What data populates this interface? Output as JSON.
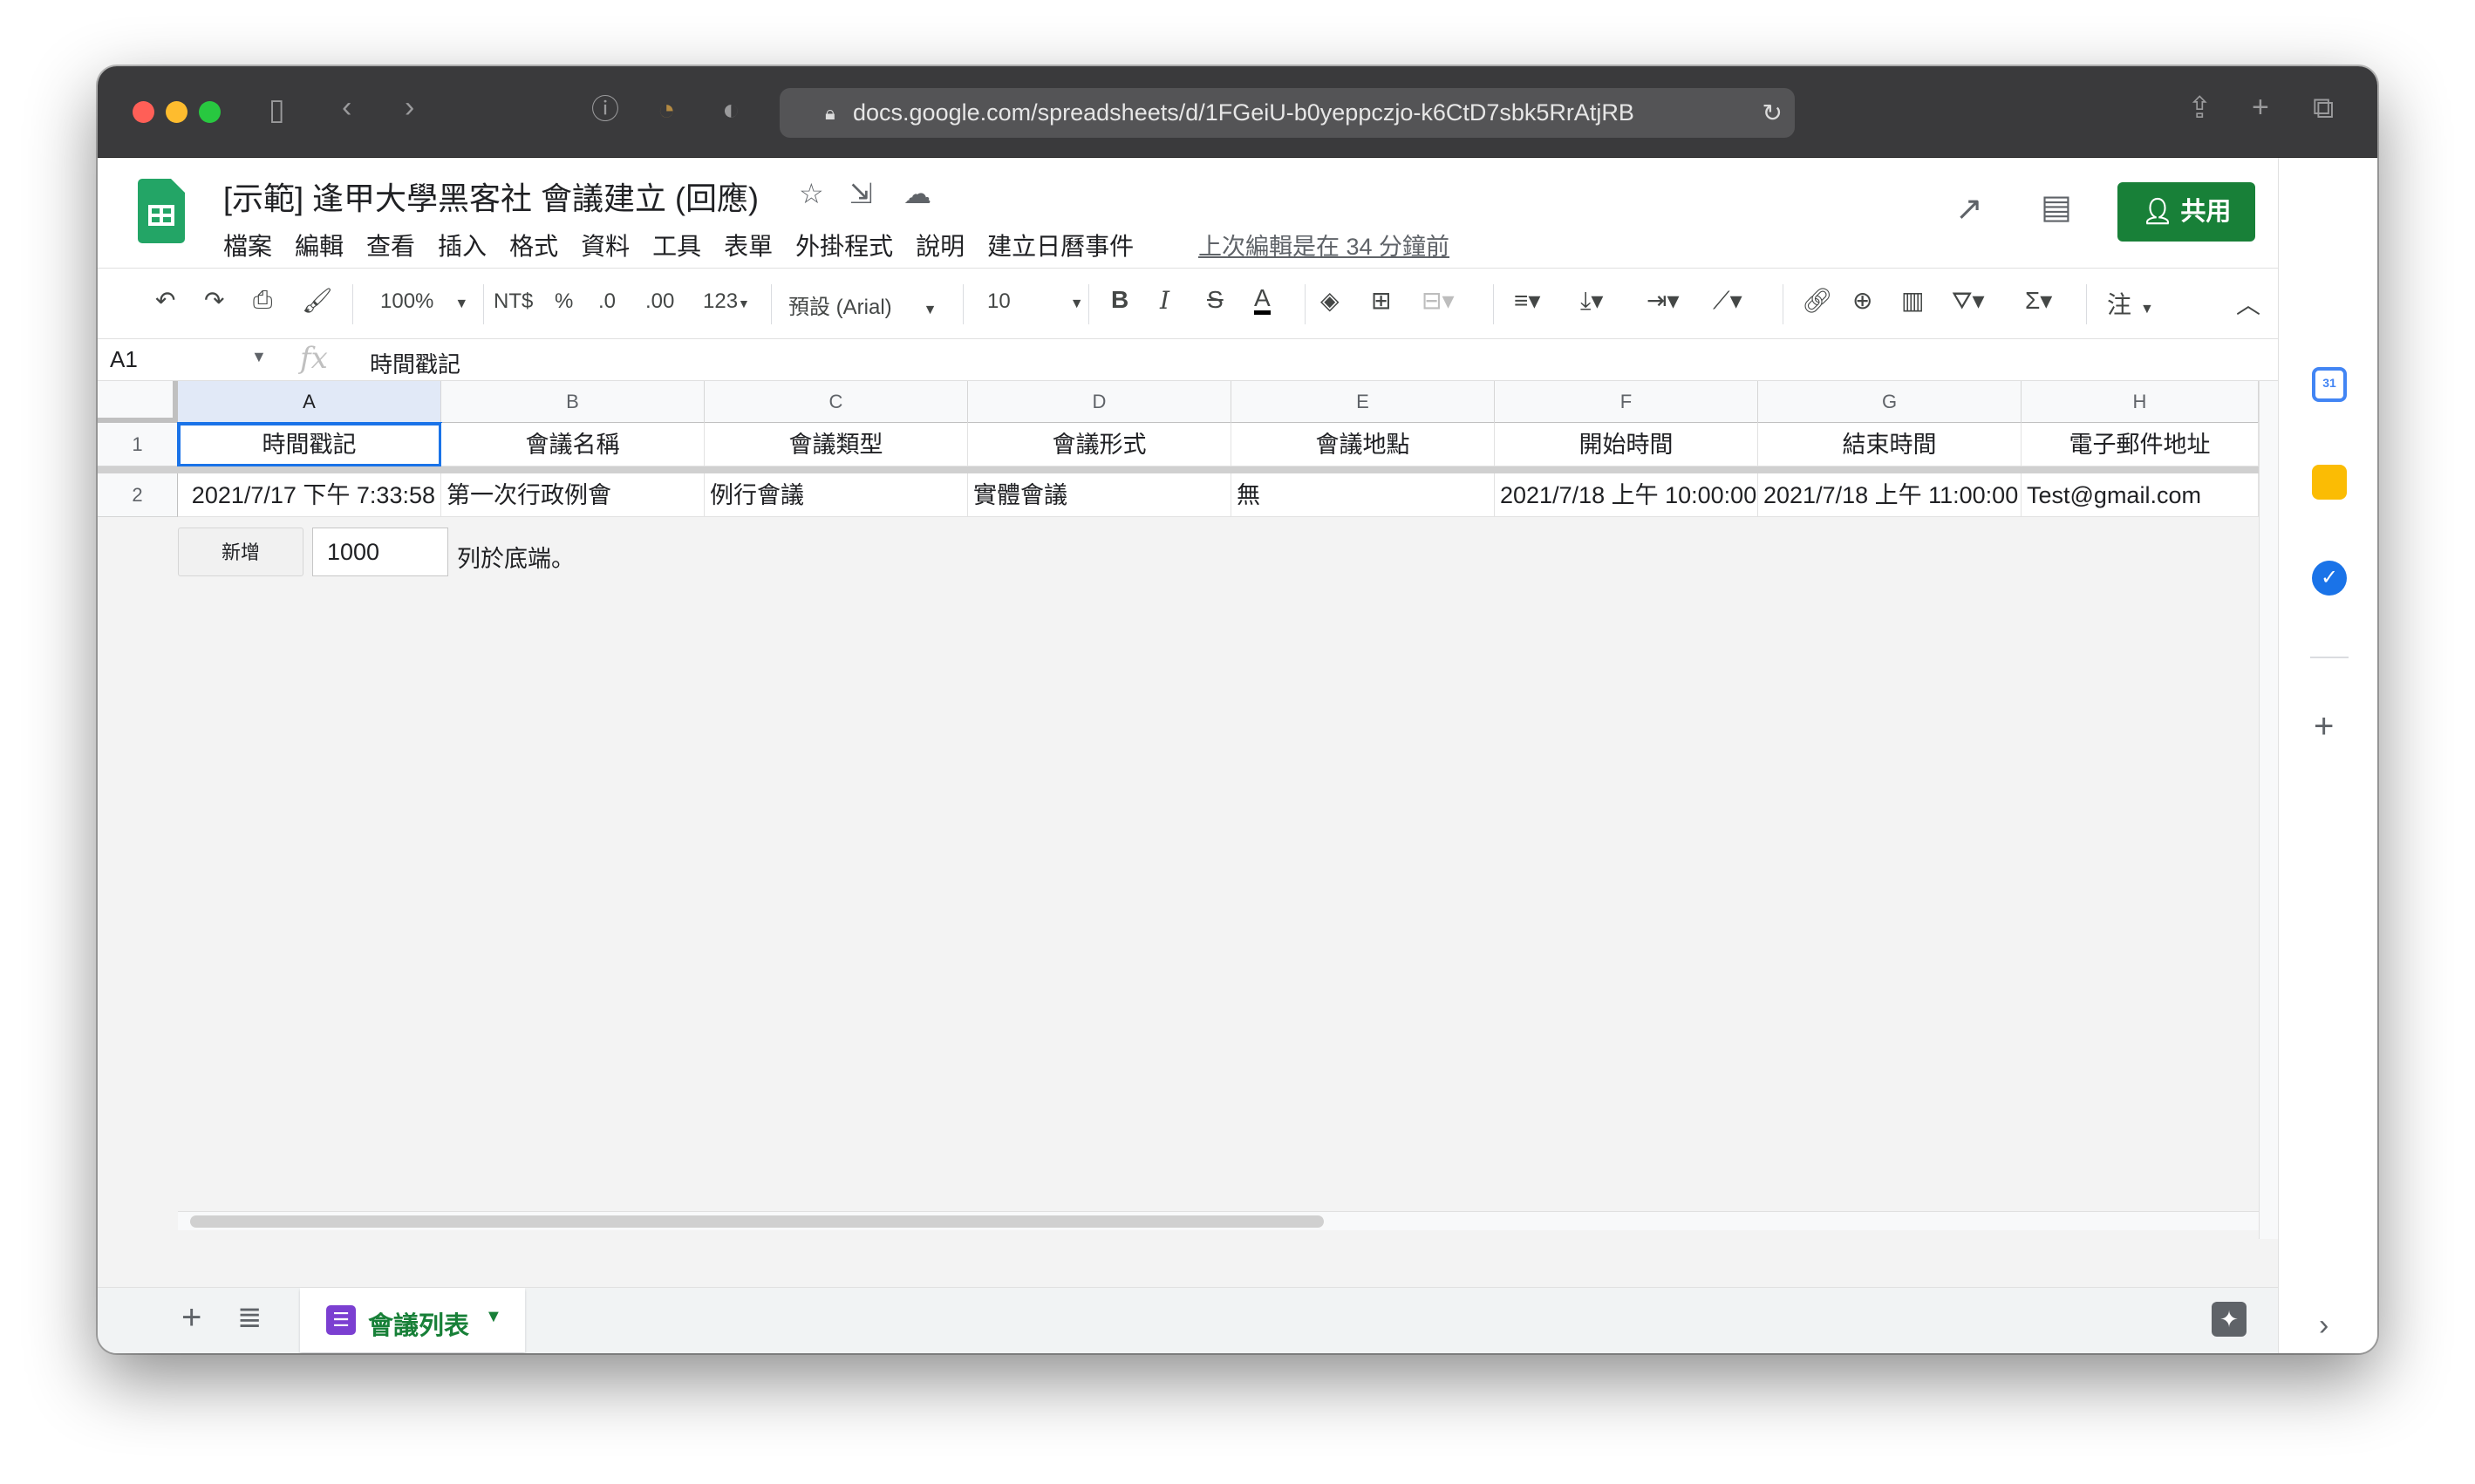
{
  "browser": {
    "url": "docs.google.com/spreadsheets/d/1FGeiU-b0yeppczjo-k6CtD7sbk5RrAtjRB",
    "icons": [
      "sidebar-icon",
      "back-icon",
      "forward-icon",
      "info-icon",
      "rss-icon",
      "shield-icon",
      "lock-icon",
      "reload-icon",
      "share-icon",
      "new-tab-icon",
      "tabs-icon"
    ]
  },
  "header": {
    "title": "[示範] 逢甲大學黑客社 會議建立 (回應)",
    "menu": [
      "檔案",
      "編輯",
      "查看",
      "插入",
      "格式",
      "資料",
      "工具",
      "表單",
      "外掛程式",
      "說明",
      "建立日曆事件"
    ],
    "last_edit": "上次編輯是在 34 分鐘前",
    "share_label": "共用",
    "brand_color": "#188038"
  },
  "toolbar": {
    "zoom": "100%",
    "currency": "NT$",
    "percent": "%",
    "decrease_decimal": ".0",
    "increase_decimal": ".00",
    "number_format": "123",
    "font": "預設 (Arial)",
    "font_size": "10",
    "bold": "B",
    "italic": "I",
    "strikethrough": "S",
    "text_color": "A",
    "input_tools": "注"
  },
  "formula": {
    "cell_ref": "A1",
    "value": "時間戳記"
  },
  "grid": {
    "columns": [
      "A",
      "B",
      "C",
      "D",
      "E",
      "F",
      "G",
      "H"
    ],
    "row_numbers": [
      "1",
      "2"
    ],
    "headers": [
      "時間戳記",
      "會議名稱",
      "會議類型",
      "會議形式",
      "會議地點",
      "開始時間",
      "結束時間",
      "電子郵件地址"
    ],
    "rows": [
      [
        "2021/7/17 下午 7:33:58",
        "第一次行政例會",
        "例行會議",
        "實體會議",
        "無",
        "2021/7/18 上午 10:00:00",
        "2021/7/18 上午 11:00:00",
        "Test@gmail.com"
      ]
    ],
    "add_button": "新增",
    "add_count": "1000",
    "add_tail": "列於底端。"
  },
  "sheet_tabs": {
    "active": "會議列表"
  },
  "side_panel": {
    "calendar_day": "31"
  }
}
